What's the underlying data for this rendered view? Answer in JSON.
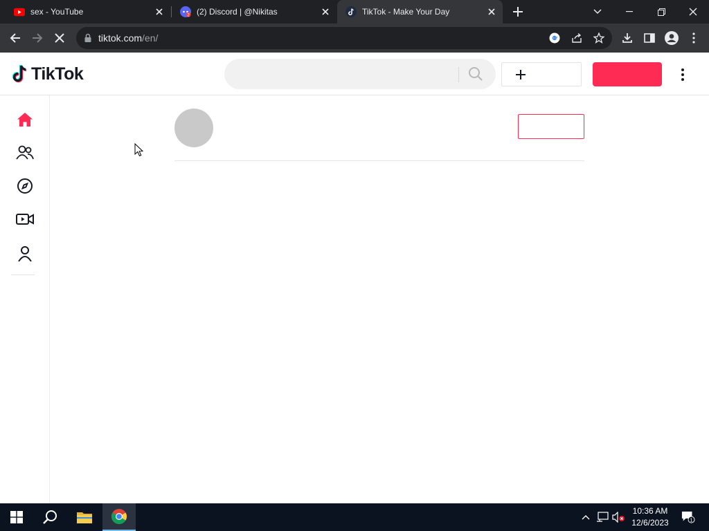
{
  "browser": {
    "tabs": [
      {
        "title": "sex - YouTube",
        "favicon": "youtube-icon",
        "active": false
      },
      {
        "title": "(2) Discord | @Nikitas",
        "favicon": "discord-icon",
        "active": false
      },
      {
        "title": "TikTok - Make Your Day",
        "favicon": "tiktok-icon",
        "active": true
      }
    ],
    "url_host": "tiktok.com",
    "url_path": "/en/"
  },
  "tiktok": {
    "logo_text": "TikTok",
    "search_placeholder": "",
    "login_label": "",
    "sidebar": [
      "home-icon",
      "following-icon",
      "explore-icon",
      "live-icon",
      "profile-icon"
    ]
  },
  "taskbar": {
    "time": "10:36 AM",
    "date": "12/6/2023",
    "notification_count": "1"
  },
  "colors": {
    "tiktok_accent": "#fe2c55",
    "chrome_dark": "#202124",
    "chrome_toolbar": "#35363a",
    "taskbar": "#0b1320"
  }
}
